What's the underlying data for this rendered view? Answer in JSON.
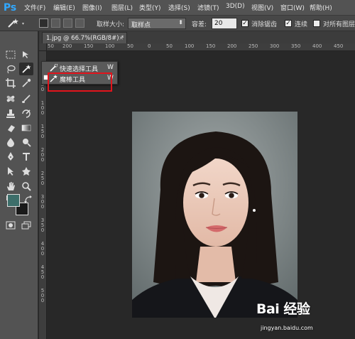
{
  "app": {
    "logo": "Ps"
  },
  "menu": [
    "文件(F)",
    "编辑(E)",
    "图像(I)",
    "图层(L)",
    "类型(Y)",
    "选择(S)",
    "滤镜(T)",
    "3D(D)",
    "视图(V)",
    "窗口(W)",
    "帮助(H)"
  ],
  "window_controls": {
    "minimize": "—",
    "restore": "▭",
    "close": "✕"
  },
  "options": {
    "sample_size_label": "取样大小:",
    "sample_size_value": "取样点",
    "tolerance_label": "容差:",
    "tolerance_value": "20",
    "antialias_label": "消除锯齿",
    "antialias_checked": true,
    "contiguous_label": "连续",
    "contiguous_checked": true,
    "all_layers_label": "对所有图层"
  },
  "document": {
    "tab_title": "1.jpg @ 66.7%(RGB/8#) *",
    "close": "×"
  },
  "ruler": {
    "h_labels": [
      "50",
      "200",
      "150",
      "100",
      "50",
      "0",
      "50",
      "100",
      "150",
      "200",
      "250",
      "300",
      "350",
      "400",
      "450"
    ],
    "v_labels": [
      "5",
      "0",
      "5",
      "0",
      "1",
      "0",
      "0",
      "1",
      "5",
      "0",
      "2",
      "0",
      "0",
      "2",
      "5",
      "0",
      "3",
      "0",
      "0",
      "3",
      "5",
      "0",
      "4",
      "0",
      "0",
      "4",
      "5",
      "0",
      "5",
      "0",
      "0"
    ]
  },
  "flyout": {
    "items": [
      {
        "label": "快速选择工具",
        "shortcut": "W",
        "icon": "quick-selection-icon",
        "selected": false
      },
      {
        "label": "魔棒工具",
        "shortcut": "W",
        "icon": "magic-wand-icon",
        "selected": true
      }
    ]
  },
  "watermark": {
    "logo": "Bai 经验",
    "url": "jingyan.baidu.com"
  },
  "colors": {
    "highlight": "#e2141c",
    "ps_blue": "#31a8ff",
    "foreground_swatch": "#3d6e6a",
    "background_swatch": "#1a1a1a"
  }
}
